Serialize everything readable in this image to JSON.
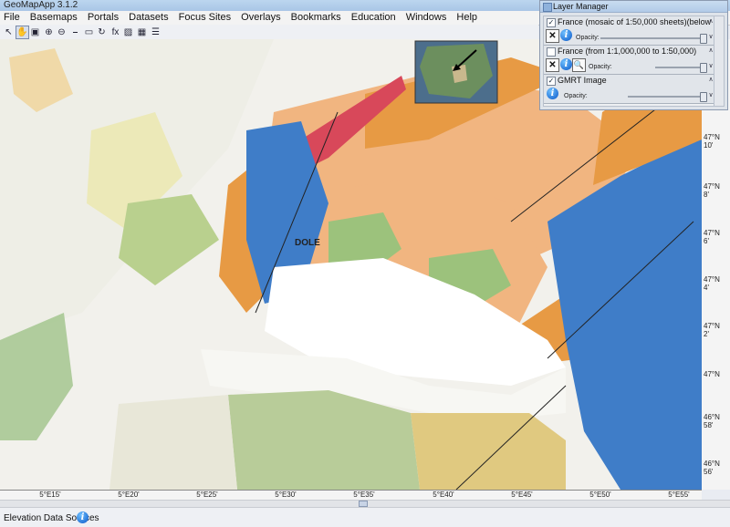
{
  "app": {
    "title": "GeoMapApp 3.1.2"
  },
  "menu": [
    "File",
    "Basemaps",
    "Portals",
    "Datasets",
    "Focus Sites",
    "Overlays",
    "Bookmarks",
    "Education",
    "Windows",
    "Help"
  ],
  "toolbar": {
    "tools": [
      {
        "name": "select-icon",
        "glyph": "↖"
      },
      {
        "name": "pan-hand-icon",
        "glyph": "✋",
        "active": true
      },
      {
        "name": "save-icon",
        "glyph": "▣"
      },
      {
        "name": "zoom-in-icon",
        "glyph": "⊕"
      },
      {
        "name": "zoom-out-icon",
        "glyph": "⊖"
      },
      {
        "name": "profile-icon",
        "glyph": "⎯"
      },
      {
        "name": "digitize-icon",
        "glyph": "▭"
      },
      {
        "name": "rotate-icon",
        "glyph": "↻"
      },
      {
        "name": "function-icon",
        "glyph": "fx"
      },
      {
        "name": "image-icon",
        "glyph": "▨"
      },
      {
        "name": "grid-icon",
        "glyph": "▦"
      },
      {
        "name": "list-icon",
        "glyph": "☰"
      }
    ]
  },
  "map": {
    "x_ticks": [
      "5°E15'",
      "5°E20'",
      "5°E25'",
      "5°E30'",
      "5°E35'",
      "5°E40'",
      "5°E45'",
      "5°E50'",
      "5°E55'"
    ],
    "y_ticks": [
      {
        "deg": "47°N",
        "min": "10'"
      },
      {
        "deg": "47°N",
        "min": "8'"
      },
      {
        "deg": "47°N",
        "min": "6'"
      },
      {
        "deg": "47°N",
        "min": "4'"
      },
      {
        "deg": "47°N",
        "min": "2'"
      },
      {
        "deg": "47°N",
        "min": ""
      },
      {
        "deg": "46°N",
        "min": "58'"
      },
      {
        "deg": "46°N",
        "min": "56'"
      }
    ],
    "town_label": "DOLE"
  },
  "layer_manager": {
    "title": "Layer Manager",
    "opacity_label": "Opacity:",
    "layers": [
      {
        "name": "France (mosaic of 1:50,000 sheets)(below",
        "checked": true,
        "opacity": 0.97
      },
      {
        "name": "France (from 1:1,000,000 to 1:50,000)",
        "checked": false,
        "opacity": 0.97
      },
      {
        "name": "GMRT Image",
        "checked": true,
        "opacity": 0.97
      }
    ]
  },
  "status": {
    "label": "Elevation Data Sources"
  },
  "colors": {
    "geology_orange": "#e79a44",
    "geology_blue": "#3f7dc8",
    "geology_red": "#d8485a",
    "geology_green": "#9cc27c",
    "geology_salmon": "#f1b580",
    "geology_yellow": "#ece9b8"
  }
}
